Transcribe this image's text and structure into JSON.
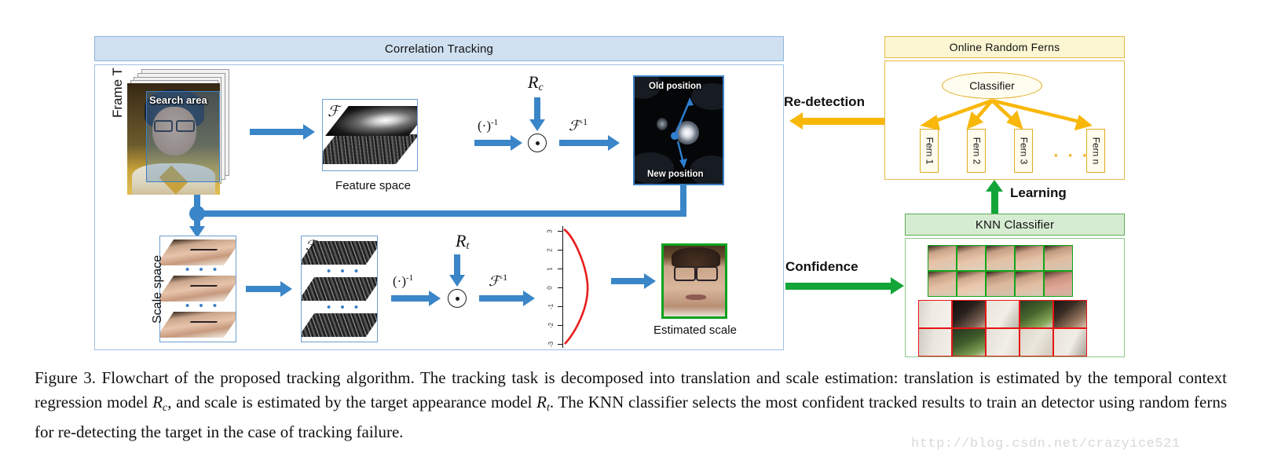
{
  "figure": {
    "correlation_tracking": {
      "title": "Correlation Tracking",
      "frame_label": "Frame T",
      "search_area_label": "Search area",
      "feature_space_caption": "Feature space",
      "fourier_symbol": "ℱ",
      "inverse_fourier_symbol": "ℱ",
      "inverse_exponent": "-1",
      "inverse_op_label": "(·)",
      "inverse_op_exponent": "-1",
      "translation_model": "R",
      "translation_model_sub": "c",
      "scale_model": "R",
      "scale_model_sub": "t",
      "old_position_label": "Old position",
      "new_position_label": "New position",
      "scale_space_label": "Scale space",
      "estimated_scale_caption": "Estimated scale",
      "ellipsis": "• • •",
      "curve_ticks": [
        "3",
        "2",
        "1",
        "0",
        "-1",
        "-2",
        "-3"
      ]
    },
    "online_random_ferns": {
      "title": "Online Random Ferns",
      "classifier_label": "Classifier",
      "ferns": [
        "Fern 1",
        "Fern 2",
        "Fern 3",
        "Fern n"
      ],
      "fern_ellipsis": "▪ ▪ ▪"
    },
    "knn_classifier": {
      "title": "KNN Classifier",
      "positive_rows": 2,
      "positive_cols": 5,
      "negative_rows": 2,
      "negative_cols": 5
    },
    "connections": {
      "redetection": "Re-detection",
      "confidence": "Confidence",
      "learning": "Learning"
    },
    "colors": {
      "correlation_header": "#cfe0f0",
      "correlation_border": "#8fb4d9",
      "ferns_header": "#fdf6d3",
      "ferns_border": "#e3bb45",
      "knn_header": "#d6ecd2",
      "knn_border": "#5aab56",
      "blue_arrow": "#3a86c8",
      "yellow_arrow": "#f9b70a",
      "green_arrow": "#13a538",
      "positive_sample": "#11a61a",
      "negative_sample": "#e81414",
      "response_curve": "#e81c1c"
    }
  },
  "caption": {
    "text_1": "Figure 3. Flowchart of the proposed tracking algorithm. The tracking task is decomposed into translation and scale estimation: translation is estimated by the temporal context regression model ",
    "math_1": "R",
    "math_1_sub": "c",
    "text_2": ", and scale is estimated by the target appearance model ",
    "math_2": "R",
    "math_2_sub": "t",
    "text_3": ". The KNN classifier selects the most confident tracked results to train an detector using random ferns for re-detecting the target in the case of tracking failure."
  },
  "watermark": "http://blog.csdn.net/crazyice521"
}
